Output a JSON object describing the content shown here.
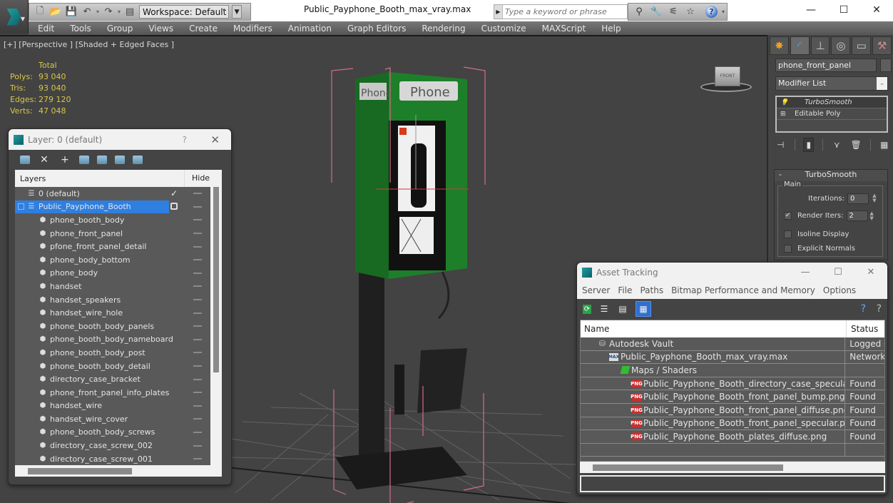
{
  "app": {
    "title": "Public_Payphone_Booth_max_vray.max",
    "workspace": "Workspace: Default",
    "search_placeholder": "Type a keyword or phrase",
    "window_controls": [
      "—",
      "☐",
      "✕"
    ]
  },
  "menu": [
    "Edit",
    "Tools",
    "Group",
    "Views",
    "Create",
    "Modifiers",
    "Animation",
    "Graph Editors",
    "Rendering",
    "Customize",
    "MAXScript",
    "Help"
  ],
  "viewport": {
    "label": "[+] [Perspective ] [Shaded + Edged Faces ]",
    "stats": {
      "header": "Total",
      "rows": [
        {
          "key": "Polys:",
          "value": "93 040"
        },
        {
          "key": "Tris:",
          "value": "93 040"
        },
        {
          "key": "Edges:",
          "value": "279 120"
        },
        {
          "key": "Verts:",
          "value": "47 048"
        }
      ]
    },
    "sign_text": "Phone",
    "viewcube_label": "FRONT"
  },
  "command_panel": {
    "object_name": "phone_front_panel",
    "modifier_list": "Modifier List",
    "stack": [
      {
        "label": "TurboSmooth",
        "selected": true
      },
      {
        "label": "Editable Poly",
        "selected": false
      }
    ],
    "rollout": {
      "title": "TurboSmooth",
      "group": "Main",
      "iterations_label": "Iterations:",
      "iterations": "0",
      "render_iters_label": "Render Iters:",
      "render_iters": "2",
      "render_iters_checked": true,
      "isoline_label": "Isoline Display",
      "explicit_normals_label": "Explicit Normals"
    }
  },
  "layer_dialog": {
    "title": "Layer: 0 (default)",
    "help": "?",
    "col_layers": "Layers",
    "col_hide": "Hide",
    "layers": [
      {
        "name": "0 (default)",
        "type": "layer",
        "current": true
      },
      {
        "name": "Public_Payphone_Booth",
        "type": "layer",
        "selected": true
      },
      {
        "name": "phone_booth_body",
        "type": "object"
      },
      {
        "name": "phone_front_panel",
        "type": "object"
      },
      {
        "name": "pfone_front_panel_detail",
        "type": "object"
      },
      {
        "name": "phone_body_bottom",
        "type": "object"
      },
      {
        "name": "phone_body",
        "type": "object"
      },
      {
        "name": "handset",
        "type": "object"
      },
      {
        "name": "handset_speakers",
        "type": "object"
      },
      {
        "name": "handset_wire_hole",
        "type": "object"
      },
      {
        "name": "phone_booth_body_panels",
        "type": "object"
      },
      {
        "name": "phone_booth_body_nameboard",
        "type": "object"
      },
      {
        "name": "phone_booth_body_post",
        "type": "object"
      },
      {
        "name": "phone_booth_body_detail",
        "type": "object"
      },
      {
        "name": "directory_case_bracket",
        "type": "object"
      },
      {
        "name": "phone_front_panel_info_plates",
        "type": "object"
      },
      {
        "name": "handset_wire",
        "type": "object"
      },
      {
        "name": "handset_wire_cover",
        "type": "object"
      },
      {
        "name": "phone_booth_body_screws",
        "type": "object"
      },
      {
        "name": "directory_case_screw_002",
        "type": "object"
      },
      {
        "name": "directory_case_screw_001",
        "type": "object"
      }
    ]
  },
  "asset_tracking": {
    "title": "Asset Tracking",
    "menu": [
      "Server",
      "File",
      "Paths",
      "Bitmap Performance and Memory",
      "Options"
    ],
    "col_name": "Name",
    "col_status": "Status",
    "rows": [
      {
        "name": "Autodesk Vault",
        "status": "Logged Out",
        "icon": "vault",
        "indent": 1
      },
      {
        "name": "Public_Payphone_Booth_max_vray.max",
        "status": "Network Path",
        "icon": "max",
        "indent": 2
      },
      {
        "name": "Maps / Shaders",
        "status": "",
        "icon": "maps",
        "indent": 3
      },
      {
        "name": "Public_Payphone_Booth_directory_case_specular.png",
        "status": "Found",
        "icon": "png",
        "indent": 4
      },
      {
        "name": "Public_Payphone_Booth_front_panel_bump.png",
        "status": "Found",
        "icon": "png",
        "indent": 4
      },
      {
        "name": "Public_Payphone_Booth_front_panel_diffuse.png",
        "status": "Found",
        "icon": "png",
        "indent": 4
      },
      {
        "name": "Public_Payphone_Booth_front_panel_specular.png",
        "status": "Found",
        "icon": "png",
        "indent": 4
      },
      {
        "name": "Public_Payphone_Booth_plates_diffuse.png",
        "status": "Found",
        "icon": "png",
        "indent": 4
      },
      {
        "name": "",
        "status": "",
        "icon": "",
        "indent": 0
      }
    ]
  }
}
